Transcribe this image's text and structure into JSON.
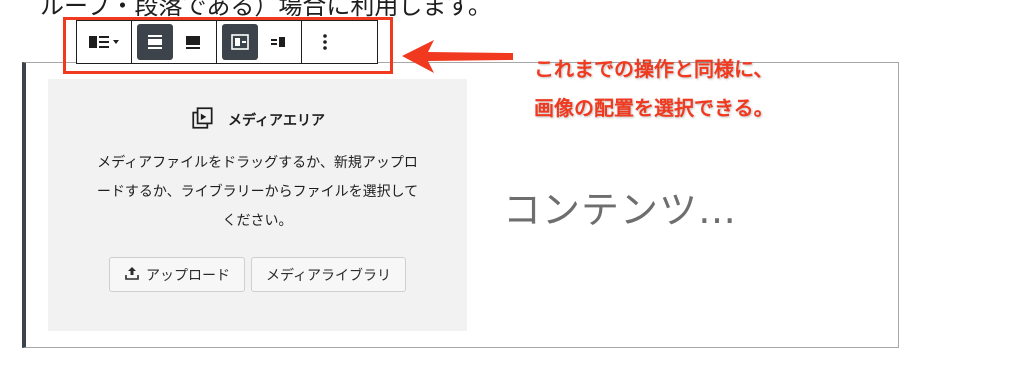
{
  "top_text": "ループ・段落である）場合に利用します。",
  "toolbar": {
    "buttons": [
      {
        "icon": "block-type-icon"
      },
      {
        "icon": "align-full-icon",
        "active": true
      },
      {
        "icon": "align-wide-icon"
      },
      {
        "icon": "media-left-icon",
        "active": true
      },
      {
        "icon": "media-right-icon"
      },
      {
        "icon": "more-options-icon"
      }
    ]
  },
  "media_placeholder": {
    "title": "メディアエリア",
    "description_lines": [
      "メディアファイルをドラッグするか、新規アップロ",
      "ードするか、ライブラリーからファイルを選択して",
      "ください。"
    ],
    "upload_label": "アップロード",
    "library_label": "メディアライブラリ",
    "icon": "media-library-icon"
  },
  "content_placeholder": "コンテンツ…",
  "annotation": {
    "line1": "これまでの操作と同様に、",
    "line2": "画像の配置を選択できる。",
    "color": "#f0391f"
  },
  "colors": {
    "accent": "#f0391f",
    "toolbar_active": "#3c434a",
    "placeholder_bg": "#f2f2f2"
  }
}
